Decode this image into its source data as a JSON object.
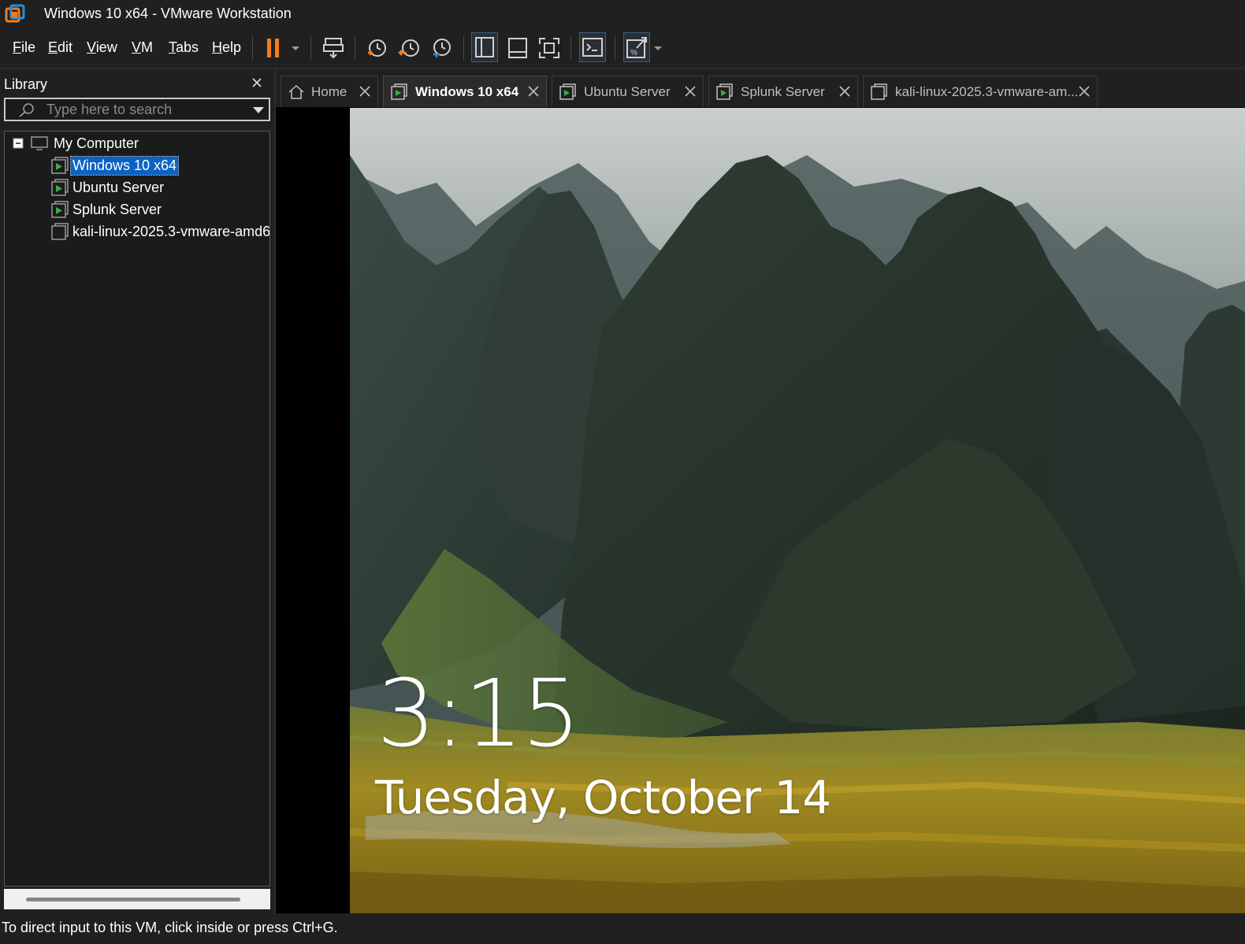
{
  "window": {
    "title": "Windows 10 x64 - VMware Workstation"
  },
  "menu": {
    "items": [
      {
        "label": "File"
      },
      {
        "label": "Edit"
      },
      {
        "label": "View"
      },
      {
        "label": "VM"
      },
      {
        "label": "Tabs"
      },
      {
        "label": "Help"
      }
    ]
  },
  "toolbar": {
    "icons": [
      "pause-icon",
      "dropdown-arrow-icon",
      "send-ctrl-alt-del-icon",
      "take-snapshot-icon",
      "revert-snapshot-icon",
      "snapshot-manager-icon",
      "show-library-icon",
      "thumbnail-bar-icon",
      "full-screen-icon",
      "console-view-icon",
      "stretch-guest-icon"
    ],
    "accent": "#f07c1d"
  },
  "library": {
    "title": "Library",
    "search_placeholder": "Type here to search",
    "tree": {
      "root": "My Computer",
      "items": [
        {
          "label": "Windows 10 x64",
          "running": true,
          "selected": true
        },
        {
          "label": "Ubuntu Server",
          "running": true,
          "selected": false
        },
        {
          "label": "Splunk Server",
          "running": true,
          "selected": false
        },
        {
          "label": "kali-linux-2025.3-vmware-amd6",
          "running": false,
          "selected": false
        }
      ]
    }
  },
  "tabs": [
    {
      "label": "Home",
      "active": false
    },
    {
      "label": "Windows 10 x64",
      "active": true
    },
    {
      "label": "Ubuntu Server",
      "active": false
    },
    {
      "label": "Splunk Server",
      "active": false
    },
    {
      "label": "kali-linux-2025.3-vmware-am...",
      "active": false
    }
  ],
  "vm_screen": {
    "time": "3:15",
    "date": "Tuesday, October 14"
  },
  "statusbar": {
    "text": "To direct input to this VM, click inside or press Ctrl+G."
  },
  "colors": {
    "selection": "#0a62c6",
    "vm_running_green": "#3cb043",
    "background": "#202020"
  }
}
